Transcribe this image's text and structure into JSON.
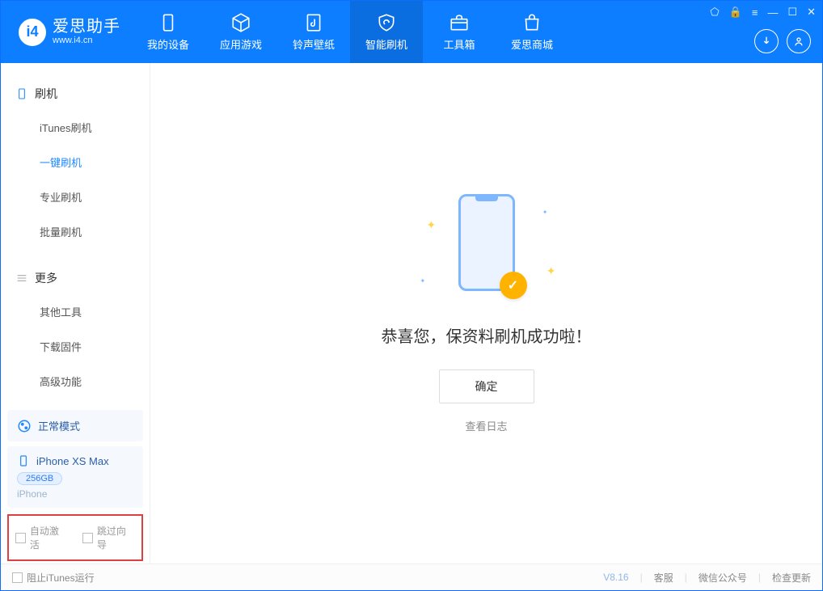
{
  "header": {
    "app_name": "爱思助手",
    "app_url": "www.i4.cn",
    "tabs": [
      {
        "label": "我的设备"
      },
      {
        "label": "应用游戏"
      },
      {
        "label": "铃声壁纸"
      },
      {
        "label": "智能刷机"
      },
      {
        "label": "工具箱"
      },
      {
        "label": "爱思商城"
      }
    ]
  },
  "sidebar": {
    "group1_title": "刷机",
    "group1_items": [
      "iTunes刷机",
      "一键刷机",
      "专业刷机",
      "批量刷机"
    ],
    "group2_title": "更多",
    "group2_items": [
      "其他工具",
      "下载固件",
      "高级功能"
    ]
  },
  "device_mode": "正常模式",
  "device": {
    "name": "iPhone XS Max",
    "storage": "256GB",
    "type": "iPhone"
  },
  "options": {
    "auto_activate": "自动激活",
    "skip_wizard": "跳过向导"
  },
  "main": {
    "success_text": "恭喜您，保资料刷机成功啦！",
    "ok_button": "确定",
    "view_log": "查看日志"
  },
  "footer": {
    "block_itunes": "阻止iTunes运行",
    "version": "V8.16",
    "links": [
      "客服",
      "微信公众号",
      "检查更新"
    ]
  }
}
